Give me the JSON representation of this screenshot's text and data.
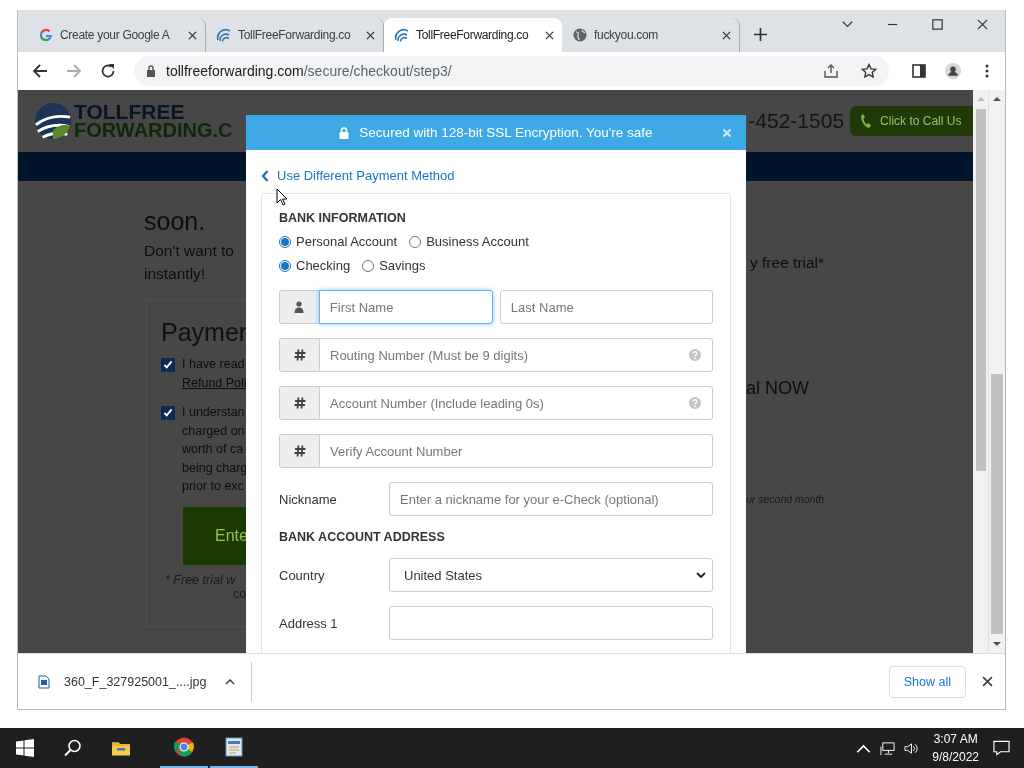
{
  "browser": {
    "tabs": [
      {
        "title": "Create your Google A",
        "selected": false
      },
      {
        "title": "TollFreeForwarding.co",
        "selected": false
      },
      {
        "title": "TollFreeForwarding.co",
        "selected": true
      },
      {
        "title": "fuckyou.com",
        "selected": false
      }
    ],
    "url_host": "tollfreeforwarding.com",
    "url_path": "/secure/checkout/step3/"
  },
  "page": {
    "logo_top": "TOLLFREE",
    "logo_bottom": "FORWARDING.C",
    "phone": "-452-1505",
    "call_button": "Click to Call Us",
    "left": {
      "heading_end": "soon.",
      "line_1": "Don't want to",
      "line_2": "instantly!",
      "payment_title": "Paymen",
      "checks": [
        {
          "checked": true,
          "lines": [
            "I have read"
          ],
          "link": "Refund Poli"
        },
        {
          "checked": true,
          "lines": [
            "I understan",
            "charged on",
            "worth of ca",
            "being charg",
            "prior to exc"
          ]
        }
      ],
      "button": "Ente",
      "note_1": "* Free trial w",
      "note_2": "co"
    },
    "right": {
      "line_1": "y free trial*",
      "cta": "al NOW",
      "note": "ur second month"
    }
  },
  "modal": {
    "banner": "Secured with 128-bit SSL Encryption. You're safe",
    "back_link": "Use Different Payment Method",
    "bank_heading": "BANK INFORMATION",
    "radio_groups": [
      [
        {
          "label": "Personal Account",
          "selected": true
        },
        {
          "label": "Business Account",
          "selected": false
        }
      ],
      [
        {
          "label": "Checking",
          "selected": true
        },
        {
          "label": "Savings",
          "selected": false
        }
      ]
    ],
    "name_fields": [
      {
        "placeholder": "First Name",
        "focused": true
      },
      {
        "placeholder": "Last Name",
        "focused": false
      }
    ],
    "number_fields": [
      {
        "placeholder": "Routing Number (Must be 9 digits)",
        "help": true
      },
      {
        "placeholder": "Account Number (Include leading 0s)",
        "help": true
      },
      {
        "placeholder": "Verify Account Number",
        "help": false
      }
    ],
    "nickname": {
      "label": "Nickname",
      "placeholder": "Enter a nickname for your e-Check (optional)"
    },
    "address_heading": "BANK ACCOUNT ADDRESS",
    "country": {
      "label": "Country",
      "value": "United States"
    },
    "address_1": {
      "label": "Address 1"
    }
  },
  "downloads": {
    "file": "360_F_327925001_....jpg",
    "show_all": "Show all"
  },
  "taskbar": {
    "time": "3:07 AM",
    "date": "9/8/2022"
  }
}
